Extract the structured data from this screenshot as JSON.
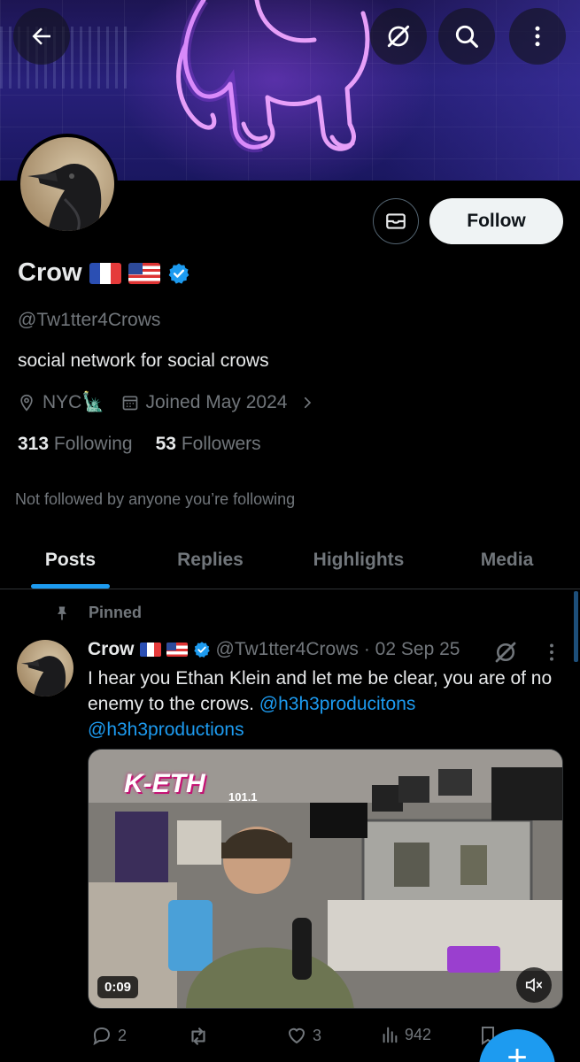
{
  "header": {
    "back_icon": "arrow-left-icon",
    "grok_icon": "grok-icon",
    "search_icon": "search-icon",
    "more_icon": "more-vertical-icon"
  },
  "profile": {
    "display_name": "Crow",
    "flags": [
      "flag-france",
      "flag-usa"
    ],
    "verified": true,
    "handle": "@Tw1tter4Crows",
    "bio": "social network for social crows",
    "location": "NYC🗽",
    "joined": "Joined May 2024",
    "following_count": "313",
    "following_label": "Following",
    "followers_count": "53",
    "followers_label": "Followers",
    "not_followed_text": "Not followed by anyone you’re following",
    "follow_label": "Follow"
  },
  "tabs": [
    {
      "label": "Posts",
      "active": true
    },
    {
      "label": "Replies",
      "active": false
    },
    {
      "label": "Highlights",
      "active": false
    },
    {
      "label": "Media",
      "active": false
    }
  ],
  "post": {
    "pinned_label": "Pinned",
    "author_name": "Crow",
    "author_handle": "@Tw1tter4Crows",
    "date": "· 02 Sep 25",
    "text_prefix": "I hear you Ethan Klein and let me be clear, you are of no enemy to the crows.",
    "mention_1": "@h3h3producitons",
    "mention_2": "@h3h3productions",
    "media": {
      "duration": "0:09",
      "logo_text": "K-ETH",
      "frequency": "101.1"
    },
    "stats": {
      "replies": "2",
      "reposts": "",
      "likes": "3",
      "views": "942"
    }
  },
  "colors": {
    "accent": "#1d9bf0",
    "background": "#000000",
    "secondary_text": "#71767b"
  }
}
